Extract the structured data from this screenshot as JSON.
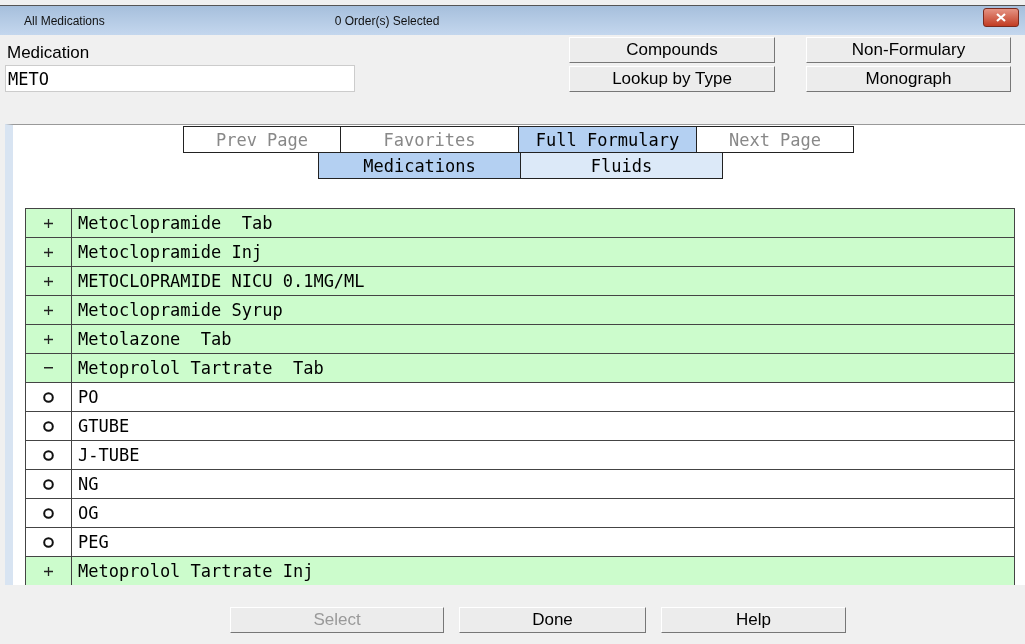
{
  "window": {
    "title": "All Medications",
    "status": "0 Order(s) Selected"
  },
  "medication": {
    "label": "Medication",
    "value": "METO"
  },
  "actions": [
    {
      "label": "Compounds"
    },
    {
      "label": "Non-Formulary"
    },
    {
      "label": "Lookup by Type"
    },
    {
      "label": "Monograph"
    }
  ],
  "nav_tabs": [
    {
      "label": "Prev Page",
      "selected": false,
      "disabled": true
    },
    {
      "label": "Favorites",
      "selected": false,
      "disabled": true
    },
    {
      "label": "Full Formulary",
      "selected": true,
      "disabled": false
    },
    {
      "label": "Next Page",
      "selected": false,
      "disabled": true
    }
  ],
  "category_tabs": [
    {
      "label": "Medications",
      "selected": true
    },
    {
      "label": "Fluids",
      "selected": false
    }
  ],
  "list": [
    {
      "kind": "group",
      "expanded": false,
      "name": "Metoclopramide  Tab"
    },
    {
      "kind": "group",
      "expanded": false,
      "name": "Metoclopramide Inj"
    },
    {
      "kind": "group",
      "expanded": false,
      "name": "METOCLOPRAMIDE NICU 0.1MG/ML"
    },
    {
      "kind": "group",
      "expanded": false,
      "name": "Metoclopramide Syrup"
    },
    {
      "kind": "group",
      "expanded": false,
      "name": "Metolazone  Tab"
    },
    {
      "kind": "group",
      "expanded": true,
      "name": "Metoprolol Tartrate  Tab"
    },
    {
      "kind": "route",
      "selected": false,
      "name": "PO"
    },
    {
      "kind": "route",
      "selected": false,
      "name": "GTUBE"
    },
    {
      "kind": "route",
      "selected": false,
      "name": "J-TUBE"
    },
    {
      "kind": "route",
      "selected": false,
      "name": "NG"
    },
    {
      "kind": "route",
      "selected": false,
      "name": "OG"
    },
    {
      "kind": "route",
      "selected": false,
      "name": "PEG"
    },
    {
      "kind": "group",
      "expanded": false,
      "name": "Metoprolol Tartrate Inj"
    }
  ],
  "buttons": [
    {
      "label": "Select",
      "disabled": true
    },
    {
      "label": "Done",
      "disabled": false
    },
    {
      "label": "Help",
      "disabled": false
    }
  ]
}
